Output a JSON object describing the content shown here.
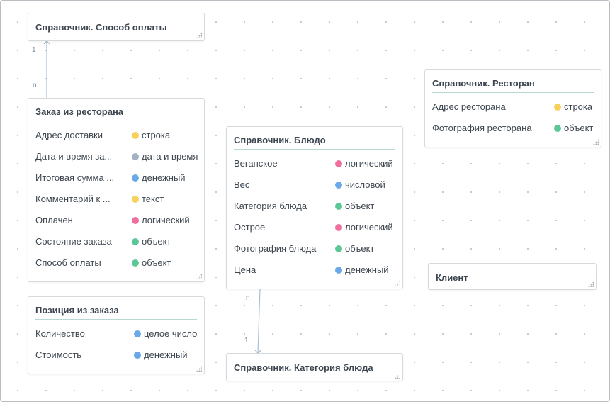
{
  "colors": {
    "string": "#f7d15c",
    "datetime": "#a4b0c4",
    "money": "#6aa8e8",
    "boolean": "#ef6fa0",
    "object": "#5cc898",
    "text": "#f7d15c",
    "number": "#6aa8e8",
    "integer": "#6aa8e8"
  },
  "entities": {
    "payment_method": {
      "title": "Справочник. Способ оплаты"
    },
    "restaurant_order": {
      "title": "Заказ из ресторана",
      "fields": [
        {
          "name": "Адрес доставки",
          "type": "строка",
          "color": "#f7d15c"
        },
        {
          "name": "Дата и время за...",
          "type": "дата и время",
          "color": "#a4b0c4"
        },
        {
          "name": "Итоговая сумма ...",
          "type": "денежный",
          "color": "#6aa8e8"
        },
        {
          "name": "Комментарий к ...",
          "type": "текст",
          "color": "#f7d15c"
        },
        {
          "name": "Оплачен",
          "type": "логический",
          "color": "#ef6fa0"
        },
        {
          "name": "Состояние заказа",
          "type": "объект",
          "color": "#5cc898"
        },
        {
          "name": "Способ оплаты",
          "type": "объект",
          "color": "#5cc898"
        }
      ]
    },
    "order_item": {
      "title": "Позиция из заказа",
      "fields": [
        {
          "name": "Количество",
          "type": "целое число",
          "color": "#6aa8e8"
        },
        {
          "name": "Стоимость",
          "type": "денежный",
          "color": "#6aa8e8"
        }
      ]
    },
    "dish": {
      "title": "Справочник. Блюдо",
      "fields": [
        {
          "name": "Веганское",
          "type": "логический",
          "color": "#ef6fa0"
        },
        {
          "name": "Вес",
          "type": "числовой",
          "color": "#6aa8e8"
        },
        {
          "name": "Категория блюда",
          "type": "объект",
          "color": "#5cc898"
        },
        {
          "name": "Острое",
          "type": "логический",
          "color": "#ef6fa0"
        },
        {
          "name": "Фотография блюда",
          "type": "объект",
          "color": "#5cc898"
        },
        {
          "name": "Цена",
          "type": "денежный",
          "color": "#6aa8e8"
        }
      ]
    },
    "dish_category": {
      "title": "Справочник. Категория блюда"
    },
    "restaurant": {
      "title": "Справочник. Ресторан",
      "fields": [
        {
          "name": "Адрес ресторана",
          "type": "строка",
          "color": "#f7d15c"
        },
        {
          "name": "Фотография ресторана",
          "type": "объект",
          "color": "#5cc898"
        }
      ]
    },
    "client": {
      "title": "Клиент"
    }
  },
  "relations": [
    {
      "from": "restaurant_order",
      "to": "payment_method",
      "from_label": "n",
      "to_label": "1"
    },
    {
      "from": "dish",
      "to": "dish_category",
      "from_label": "n",
      "to_label": "1"
    }
  ]
}
